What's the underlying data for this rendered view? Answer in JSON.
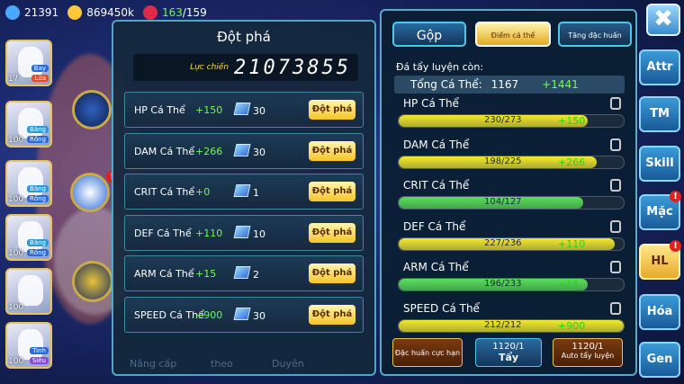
{
  "resources": {
    "coins": "21391",
    "gold": "869450k",
    "stamina_current": "163",
    "stamina_sep": "/",
    "stamina_max": "159"
  },
  "characters": [
    {
      "level": "17",
      "tags": [
        "Bay",
        "Lửa"
      ],
      "tag_colors": [
        "#2a6ad8",
        "#e84a2a"
      ]
    },
    {
      "level": "100",
      "tags": [
        "Băng",
        "Rồng"
      ],
      "tag_colors": [
        "#2a9ad8",
        "#2a6ad8"
      ]
    },
    {
      "level": "100",
      "tags": [
        "Băng",
        "Rồng"
      ],
      "tag_colors": [
        "#2a9ad8",
        "#2a6ad8"
      ]
    },
    {
      "level": "100",
      "tags": [
        "Băng",
        "Rồng"
      ],
      "tag_colors": [
        "#2a9ad8",
        "#2a6ad8"
      ]
    },
    {
      "level": "100",
      "tags": [],
      "tag_colors": []
    },
    {
      "level": "100",
      "tags": [
        "Tinh",
        "Siêu"
      ],
      "tag_colors": [
        "#2a6ad8",
        "#8a4ad8"
      ]
    }
  ],
  "breakthrough": {
    "title": "Đột phá",
    "power_label": "Lực chiến",
    "power_value": "21073855",
    "rows": [
      {
        "name": "HP Cá Thể",
        "bonus": "+150",
        "cost": "30",
        "button": "Đột phá"
      },
      {
        "name": "DAM Cá Thể",
        "bonus": "+266",
        "cost": "30",
        "button": "Đột phá"
      },
      {
        "name": "CRIT Cá Thể",
        "bonus": "+0",
        "cost": "1",
        "button": "Đột phá"
      },
      {
        "name": "DEF Cá Thể",
        "bonus": "+110",
        "cost": "10",
        "button": "Đột phá"
      },
      {
        "name": "ARM Cá Thể",
        "bonus": "+15",
        "cost": "2",
        "button": "Đột phá"
      },
      {
        "name": "SPEED Cá Thể",
        "bonus": "+900",
        "cost": "30",
        "button": "Đột phá"
      }
    ]
  },
  "bottom_tabs": [
    "Nâng cấp",
    "theo",
    "Duyên"
  ],
  "training": {
    "tabs": [
      "Gộp",
      "Điểm cá thể",
      "Tăng đặc huấn"
    ],
    "subtitle": "Đá tẩy luyện còn:",
    "total_label": "Tổng Cá Thể:",
    "total_value": "1167",
    "total_plus": "+1441",
    "stats": [
      {
        "name": "HP Cá Thể",
        "value": "230/273",
        "plus": "+150",
        "fill": 0.84,
        "color": "#f5ea2a"
      },
      {
        "name": "DAM Cá Thể",
        "value": "198/225",
        "plus": "+266",
        "fill": 0.88,
        "color": "#f5ea2a"
      },
      {
        "name": "CRIT Cá Thể",
        "value": "104/127",
        "plus": "",
        "fill": 0.82,
        "color": "#5ae05a"
      },
      {
        "name": "DEF Cá Thể",
        "value": "227/236",
        "plus": "+110",
        "fill": 0.96,
        "color": "#f5ea2a"
      },
      {
        "name": "ARM Cá Thể",
        "value": "196/233",
        "plus": "+15",
        "fill": 0.84,
        "color": "#5ae05a"
      },
      {
        "name": "SPEED Cá Thể",
        "value": "212/212",
        "plus": "+900",
        "fill": 1.0,
        "color": "#f5ea2a"
      }
    ],
    "buttons": {
      "limit": "Đặc huấn cực hạn",
      "wash_count": "1120/1",
      "wash": "Tẩy",
      "auto_count": "1120/1",
      "auto": "Auto tẩy luyện"
    }
  },
  "sidebar": [
    {
      "label": "Attr",
      "alert": false
    },
    {
      "label": "TM",
      "alert": false
    },
    {
      "label": "Skill",
      "alert": false
    },
    {
      "label": "Mặc",
      "alert": true
    },
    {
      "label": "HL",
      "alert": true
    },
    {
      "label": "Hóa",
      "alert": false
    },
    {
      "label": "Gen",
      "alert": false
    }
  ],
  "close_label": "✖",
  "alert_mark": "!"
}
